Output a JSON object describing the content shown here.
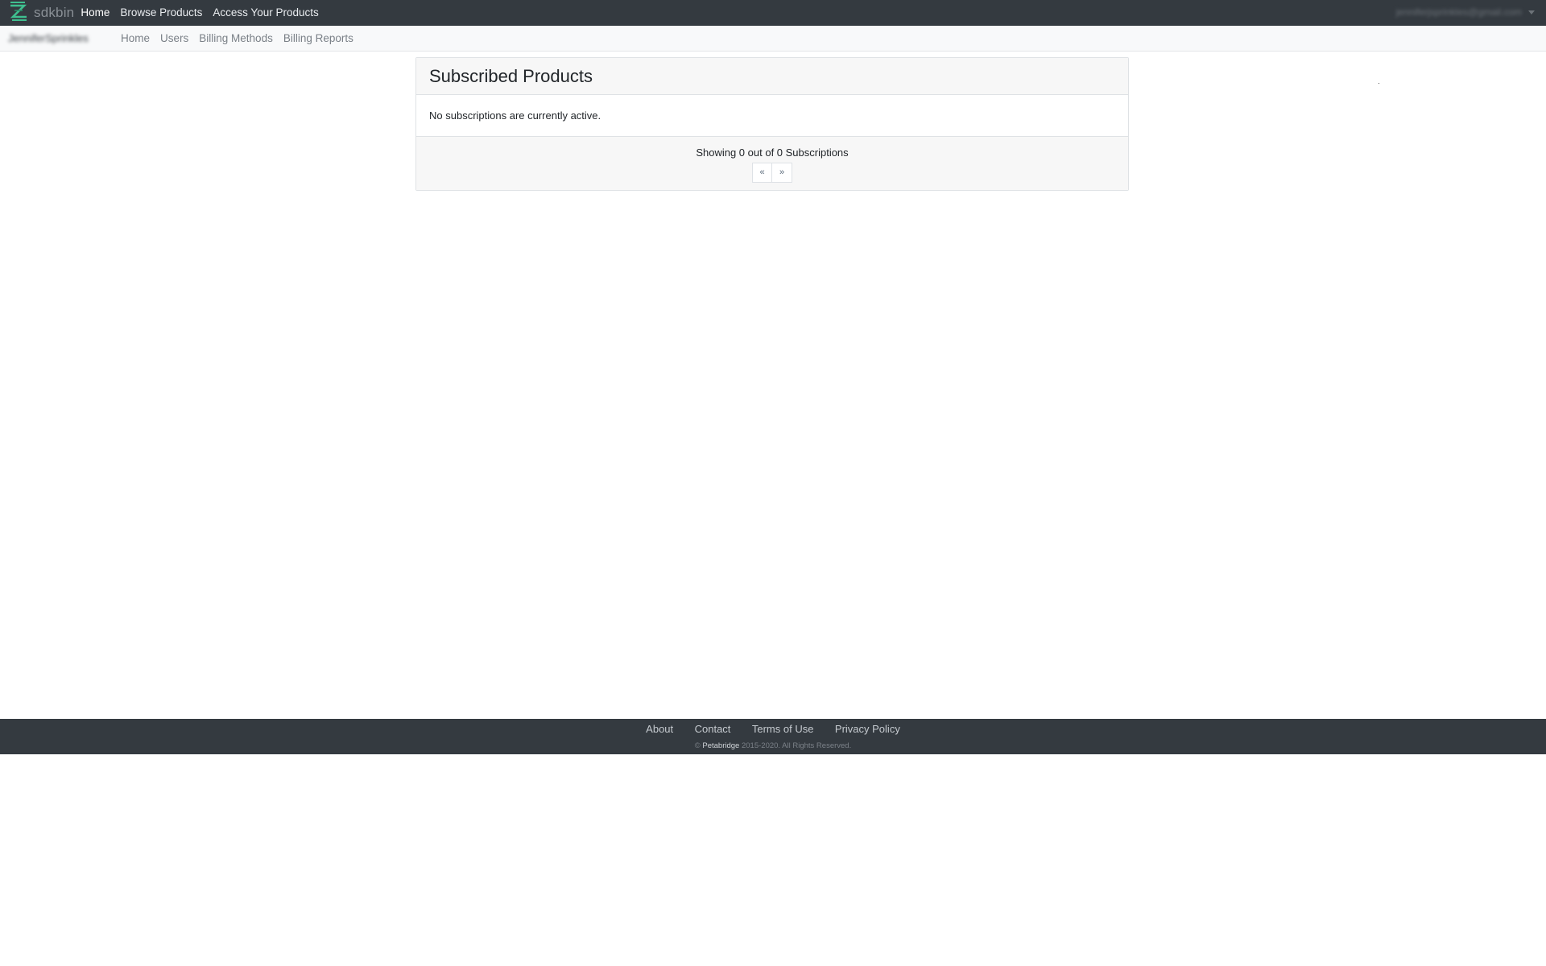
{
  "topbar": {
    "brand": "sdkbin",
    "links": [
      "Home",
      "Browse Products",
      "Access Your Products"
    ],
    "user_email": "jenniferjsprinkles@gmail.com"
  },
  "subbar": {
    "account": "JenniferSprinkles",
    "links": [
      "Home",
      "Users",
      "Billing Methods",
      "Billing Reports"
    ]
  },
  "card": {
    "title": "Subscribed Products",
    "empty_message": "No subscriptions are currently active.",
    "showing": "Showing 0 out of 0 Subscriptions",
    "prev": "«",
    "next": "»"
  },
  "footer": {
    "links": [
      "About",
      "Contact",
      "Terms of Use",
      "Privacy Policy"
    ],
    "copyright_symbol": "©",
    "company": "Petabridge",
    "copyright_rest": "2015-2020. All Rights Reserved."
  },
  "colors": {
    "navbar": "#343a40",
    "subbar": "#f8f9fa",
    "brand_icon": "#3fbf8f"
  }
}
